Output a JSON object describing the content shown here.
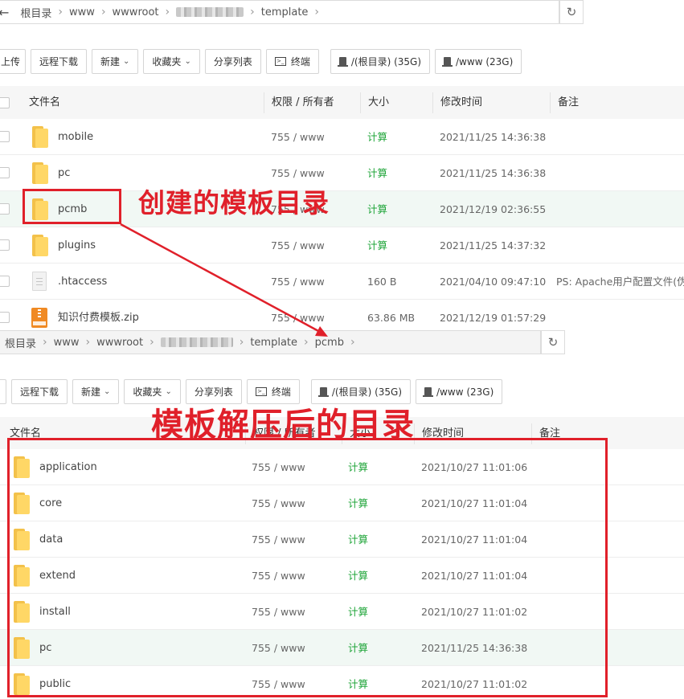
{
  "top": {
    "breadcrumb": {
      "back_icon": "back-arrow-icon",
      "items": [
        "根目录",
        "www",
        "wwwroot",
        "",
        "template"
      ],
      "refresh_icon": "refresh-icon"
    },
    "toolbar": {
      "upload_label": "上传",
      "remote_download_label": "远程下载",
      "new_label": "新建",
      "favorites_label": "收藏夹",
      "share_list_label": "分享列表",
      "terminal_label": "终端",
      "disk_root_label": "/(根目录) (35G)",
      "disk_www_label": "/www (23G)"
    },
    "columns": [
      "文件名",
      "权限 / 所有者",
      "大小",
      "修改时间",
      "备注"
    ],
    "rows": [
      {
        "name": "mobile",
        "perm": "755 / www",
        "size": "计算",
        "mtime": "2021/11/25 14:36:38",
        "note": "",
        "type": "folder"
      },
      {
        "name": "pc",
        "perm": "755 / www",
        "size": "计算",
        "mtime": "2021/11/25 14:36:38",
        "note": "",
        "type": "folder"
      },
      {
        "name": "pcmb",
        "perm": "755 / www",
        "size": "计算",
        "mtime": "2021/12/19 02:36:55",
        "note": "",
        "type": "folder"
      },
      {
        "name": "plugins",
        "perm": "755 / www",
        "size": "计算",
        "mtime": "2021/11/25 14:37:32",
        "note": "",
        "type": "folder"
      },
      {
        "name": ".htaccess",
        "perm": "755 / www",
        "size": "160 B",
        "mtime": "2021/04/10 09:47:10",
        "note": "PS: Apache用户配置文件(伪静",
        "type": "file"
      },
      {
        "name": "知识付费模板.zip",
        "perm": "755 / www",
        "size": "63.86 MB",
        "mtime": "2021/12/19 01:57:29",
        "note": "",
        "type": "zip"
      }
    ]
  },
  "bottom": {
    "breadcrumb": {
      "items": [
        "根目录",
        "www",
        "wwwroot",
        "",
        "template",
        "pcmb"
      ],
      "refresh_icon": "refresh-icon"
    },
    "toolbar": {
      "remote_download_label": "远程下载",
      "new_label": "新建",
      "favorites_label": "收藏夹",
      "share_list_label": "分享列表",
      "terminal_label": "终端",
      "disk_root_label": "/(根目录) (35G)",
      "disk_www_label": "/www (23G)"
    },
    "columns": [
      "文件名",
      "权限 / 所有者",
      "大小",
      "修改时间",
      "备注"
    ],
    "rows": [
      {
        "name": "application",
        "perm": "755 / www",
        "size": "计算",
        "mtime": "2021/10/27 11:01:06"
      },
      {
        "name": "core",
        "perm": "755 / www",
        "size": "计算",
        "mtime": "2021/10/27 11:01:04"
      },
      {
        "name": "data",
        "perm": "755 / www",
        "size": "计算",
        "mtime": "2021/10/27 11:01:04"
      },
      {
        "name": "extend",
        "perm": "755 / www",
        "size": "计算",
        "mtime": "2021/10/27 11:01:04"
      },
      {
        "name": "install",
        "perm": "755 / www",
        "size": "计算",
        "mtime": "2021/10/27 11:01:02"
      },
      {
        "name": "pc",
        "perm": "755 / www",
        "size": "计算",
        "mtime": "2021/11/25 14:36:38"
      },
      {
        "name": "public",
        "perm": "755 / www",
        "size": "计算",
        "mtime": "2021/10/27 11:01:02"
      }
    ]
  },
  "annotations": {
    "created_template_dir": "创建的模板目录",
    "unzipped_template_dir": "模板解压后的目录",
    "accent_color": "#e0202a"
  },
  "colors": {
    "calc_green": "#20a53a",
    "row_highlight": "#f1f8f4",
    "folder_yellow": "#ffd766"
  }
}
